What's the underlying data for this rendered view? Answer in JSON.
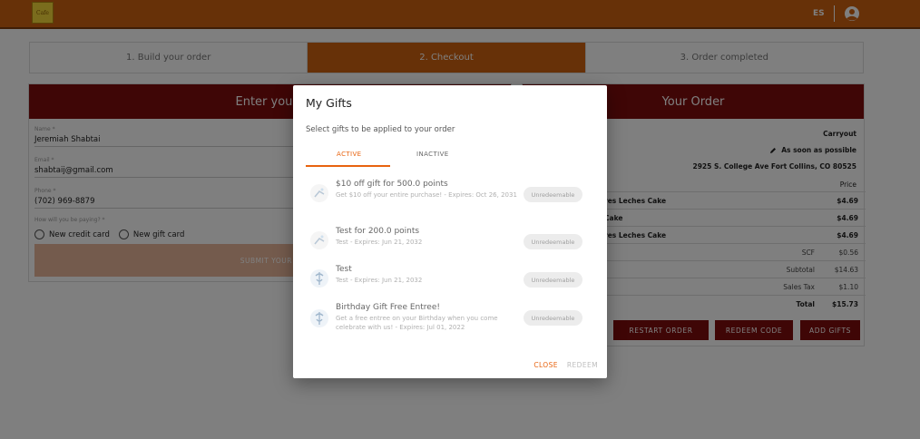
{
  "header": {
    "logo_text": "Cafe",
    "language": "ES"
  },
  "steps": [
    {
      "label": "1. Build your order"
    },
    {
      "label": "2. Checkout"
    },
    {
      "label": "3. Order completed"
    }
  ],
  "info_panel": {
    "title": "Enter your i",
    "name_label": "Name *",
    "name_value": "Jeremiah Shabtai",
    "email_label": "Email *",
    "email_value": "shabtaij@gmail.com",
    "phone_label": "Phone *",
    "phone_value": "(702) 969-8879",
    "payment_label": "How will you be paying? *",
    "payment_options": [
      "New credit card",
      "New gift card"
    ],
    "submit_label": "SUBMIT YOUR O"
  },
  "order_panel": {
    "title": "Your Order",
    "mode": "Carryout",
    "time": "As soon as possible",
    "address": "2925 S. College Ave Fort Collins, CO 80525",
    "price_header": "Price",
    "items": [
      {
        "name": "res Leches Cake",
        "price": "$4.69"
      },
      {
        "name": "Cake",
        "price": "$4.69"
      },
      {
        "name": "res Leches Cake",
        "price": "$4.69"
      }
    ],
    "summary": [
      {
        "label": "SCF",
        "value": "$0.56"
      },
      {
        "label": "Subtotal",
        "value": "$14.63"
      },
      {
        "label": "Sales Tax",
        "value": "$1.10"
      }
    ],
    "total_label": "Total",
    "total_value": "$15.73",
    "buttons": {
      "restart": "RESTART ORDER",
      "redeem_code": "REDEEM CODE",
      "add_gifts": "ADD GIFTS"
    }
  },
  "modal": {
    "title": "My Gifts",
    "subtitle": "Select gifts to be applied to your order",
    "tabs": {
      "active": "ACTIVE",
      "inactive": "INACTIVE"
    },
    "gifts": [
      {
        "title": "$10 off gift for 500.0 points",
        "desc": "Get $10 off your entire purchase! - Expires: Oct 26, 2031",
        "status": "Unredeemable"
      },
      {
        "title": "Test for 200.0 points",
        "desc": "Test - Expires: Jun 21, 2032",
        "status": "Unredeemable"
      },
      {
        "title": "Test",
        "desc": "Test - Expires: Jun 21, 2032",
        "status": "Unredeemable"
      },
      {
        "title": "Birthday Gift Free Entree!",
        "desc": "Get a free entree on your Birthday when you come celebrate with us! - Expires: Jul 01, 2022",
        "status": "Unredeemable"
      }
    ],
    "actions": {
      "close": "CLOSE",
      "redeem": "REDEEM"
    }
  }
}
